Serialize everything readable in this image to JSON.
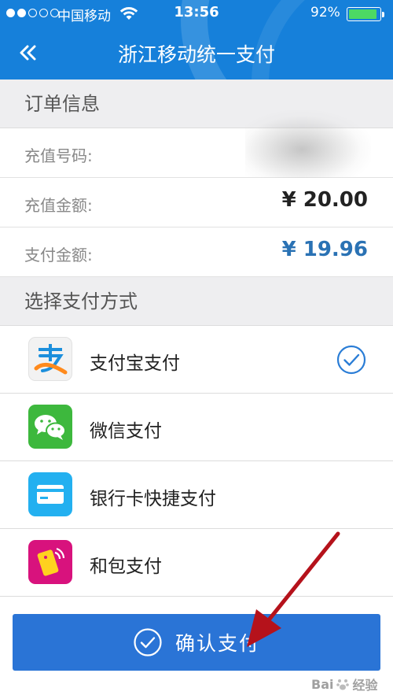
{
  "status_bar": {
    "carrier": "中国移动",
    "time": "13:56",
    "battery_percent": "92%",
    "battery_level": 0.92,
    "signal_strength": 2
  },
  "nav": {
    "title": "浙江移动统一支付",
    "back_icon": "double-chevron-left-icon"
  },
  "order_section": {
    "header": "订单信息",
    "rows": [
      {
        "label": "充值号码:",
        "value": ""
      },
      {
        "label": "充值金额:",
        "value": "¥ 20.00"
      },
      {
        "label": "支付金额:",
        "value": "¥ 19.96"
      }
    ]
  },
  "payment_section": {
    "header": "选择支付方式",
    "methods": [
      {
        "label": "支付宝支付",
        "icon": "alipay-icon",
        "selected": true
      },
      {
        "label": "微信支付",
        "icon": "wechat-icon",
        "selected": false
      },
      {
        "label": "银行卡快捷支付",
        "icon": "bank-card-icon",
        "selected": false
      },
      {
        "label": "和包支付",
        "icon": "hebao-icon",
        "selected": false
      }
    ]
  },
  "confirm_button": {
    "label": "确认支付",
    "icon": "check-circle-icon"
  },
  "colors": {
    "brand_blue": "#1680da",
    "button_blue": "#2a74d6",
    "amount_blue": "#2a72b4",
    "section_bg": "#eeeef0",
    "annotation_red": "#b5121b"
  },
  "watermark": {
    "text_a": "Bai",
    "text_b": "经验"
  }
}
